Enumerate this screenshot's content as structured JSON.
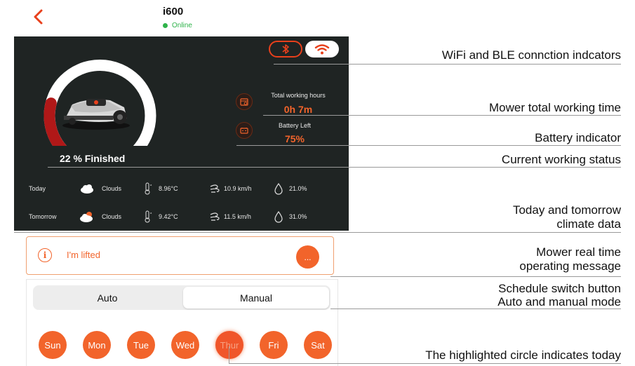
{
  "header": {
    "title": "i600",
    "status": "Online"
  },
  "dashboard": {
    "progress_text": "22 % Finished",
    "progress_fraction": 0.22,
    "stats": [
      {
        "icon": "calendar-clock-icon",
        "label": "Total working hours",
        "value": "0h 7m"
      },
      {
        "icon": "battery-icon",
        "label": "Battery Left",
        "value": "75%"
      }
    ],
    "weather": [
      {
        "day": "Today",
        "condition": "Clouds",
        "temp": "8.96°C",
        "wind": "10.9 km/h",
        "humidity": "21.0%"
      },
      {
        "day": "Tomorrow",
        "condition": "Clouds",
        "temp": "9.42°C",
        "wind": "11.5 km/h",
        "humidity": "31.0%"
      }
    ]
  },
  "message": {
    "text": "I'm lifted",
    "more": "..."
  },
  "schedule": {
    "modes": [
      "Auto",
      "Manual"
    ],
    "selected_mode": "Manual",
    "days": [
      "Sun",
      "Mon",
      "Tue",
      "Wed",
      "Thur",
      "Fri",
      "Sat"
    ],
    "today": "Thur"
  },
  "annotations": {
    "connection": "WiFi and BLE connction indcators",
    "working_time": "Mower total working time",
    "battery": "Battery indicator",
    "status": "Current working status",
    "climate_l1": "Today and tomorrow",
    "climate_l2": "climate data",
    "message_l1": "Mower real time",
    "message_l2": "operating message",
    "switch_l1": "Schedule switch button",
    "switch_l2": "Auto and manual mode",
    "today": "The highlighted circle indicates today"
  },
  "colors": {
    "accent": "#f2642b",
    "dark_panel": "#1f2423",
    "online": "#2fb34a",
    "gauge_track": "#ffffff",
    "gauge_progress": "#b01818"
  }
}
